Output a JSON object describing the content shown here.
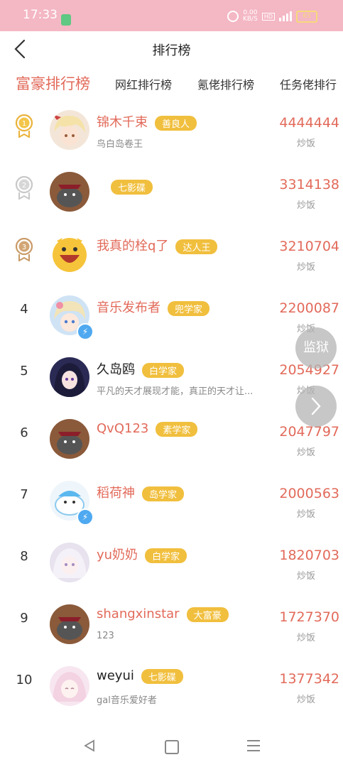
{
  "status": {
    "time": "17:33",
    "speed": "0.00",
    "speed_unit": "KB/S",
    "hd": "HD",
    "battery": "65"
  },
  "header": {
    "title": "排行榜"
  },
  "tabs": [
    "富豪排行榜",
    "网红排行榜",
    "氪佬排行榜",
    "任务佬排行"
  ],
  "unit": "炒饭",
  "rows": [
    {
      "rank": "1",
      "name": "锦木千束",
      "badge": "善良人",
      "desc": "鸟白岛卷王",
      "value": "4444444"
    },
    {
      "rank": "2",
      "name": "",
      "badge": "七影碟",
      "desc": "",
      "value": "3314138"
    },
    {
      "rank": "3",
      "name": "我真的栓q了",
      "badge": "达人王",
      "desc": "",
      "value": "3210704"
    },
    {
      "rank": "4",
      "name": "音乐发布者",
      "badge": "兜学家",
      "desc": "",
      "value": "2200087"
    },
    {
      "rank": "5",
      "name": "久岛鸥",
      "badge": "白学家",
      "desc": "平凡的天才展现才能，真正的天才让...",
      "value": "2054927"
    },
    {
      "rank": "6",
      "name": "QvQ123",
      "badge": "素学家",
      "desc": "",
      "value": "2047797"
    },
    {
      "rank": "7",
      "name": "稻荷神",
      "badge": "岛学家",
      "desc": "",
      "value": "2000563"
    },
    {
      "rank": "8",
      "name": "yu奶奶",
      "badge": "白学家",
      "desc": "",
      "value": "1820703"
    },
    {
      "rank": "9",
      "name": "shangxinstar",
      "badge": "大富豪",
      "desc": "123",
      "value": "1727370"
    },
    {
      "rank": "10",
      "name": "weyui",
      "badge": "七影碟",
      "desc": "gal音乐爱好者",
      "value": "1377342"
    }
  ],
  "float": {
    "label": "监狱"
  },
  "colors": {
    "accent": "#e26a5a",
    "badge": "#f1bf3e",
    "statusbar": "#f4b7c4"
  }
}
